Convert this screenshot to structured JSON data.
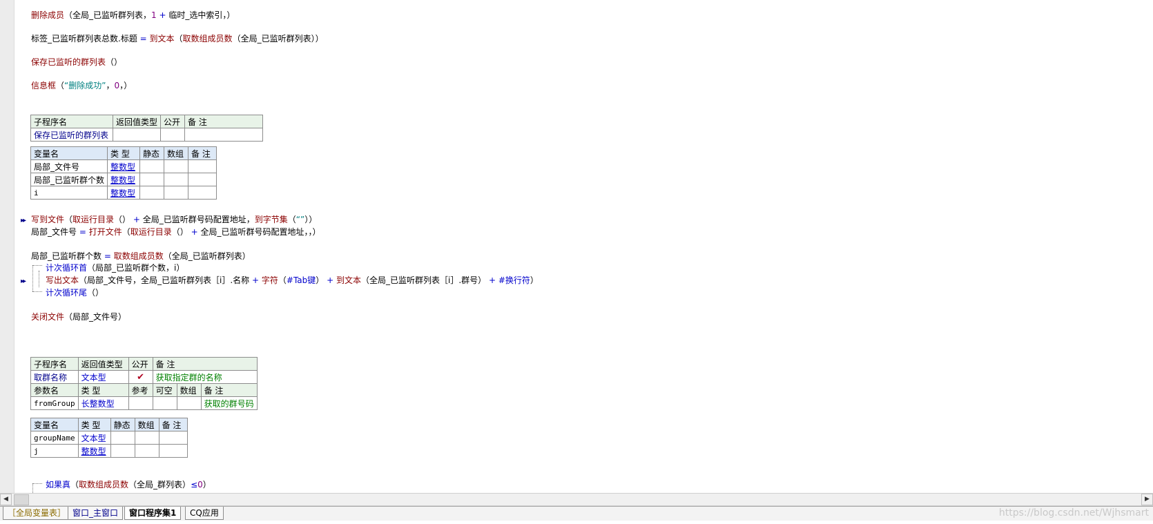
{
  "code": {
    "l1": {
      "fn": "删除成员",
      "args": "（全局_已监听群列表，",
      "num": "1",
      "op": " + ",
      "rest": "临时_选中索引，）"
    },
    "l2": {
      "a": "标签_已监听群列表总数.标题",
      "op": " = ",
      "fn": "到文本",
      "b": "（",
      "fn2": "取数组成员数",
      "c": "（全局_已监听群列表））"
    },
    "l3": {
      "fn": "保存已监听的群列表",
      "args": "（）"
    },
    "l4": {
      "fn": "信息框",
      "a": "（",
      "str": "“删除成功”",
      "b": "，",
      "num": "0",
      "c": "，）"
    },
    "l5": {
      "fn": "写到文件",
      "a": "（",
      "fn2": "取运行目录",
      "b": "（）",
      "op": " + ",
      "c": "全局_已监听群号码配置地址，",
      "fn3": "到字节集",
      "d": "（",
      "str": "“”",
      "e": "））"
    },
    "l6": {
      "a": "局部_文件号",
      "op": " = ",
      "fn": "打开文件",
      "b": "（",
      "fn2": "取运行目录",
      "c": "（）",
      "op2": " + ",
      "d": "全局_已监听群号码配置地址，，）"
    },
    "l7": {
      "a": "局部_已监听群个数",
      "op": " = ",
      "fn": "取数组成员数",
      "b": "（全局_已监听群列表）"
    },
    "l8": {
      "cmd": "计次循环首",
      "args": "（局部_已监听群个数，i）"
    },
    "l9": {
      "fn": "写出文本",
      "a": "（局部_文件号，全局_已监听群列表［i］.名称",
      "op": " + ",
      "fn2": "字符",
      "b": "（",
      "cmd": "#Tab键",
      "c": "）",
      "op2": " + ",
      "fn3": "到文本",
      "d": "（全局_已监听群列表［i］.群号）",
      "op3": " + ",
      "cmd2": "#换行符",
      "e": "）"
    },
    "l10": {
      "cmd": "计次循环尾",
      "args": "（）"
    },
    "l11": {
      "fn": "关闭文件",
      "args": "（局部_文件号）"
    },
    "l12": {
      "cmd": "如果真",
      "a": "（",
      "fn": "取数组成员数",
      "b": "（全局_群列表）",
      "op": "≤",
      "num": "0",
      "c": "）"
    }
  },
  "sub1": {
    "headers": [
      "子程序名",
      "返回值类型",
      "公开",
      "备 注"
    ],
    "name": "保存已监听的群列表",
    "var_headers": [
      "变量名",
      "类 型",
      "静态",
      "数组",
      "备 注"
    ],
    "vars": [
      {
        "name": "局部_文件号",
        "type": "整数型"
      },
      {
        "name": "局部_已监听群个数",
        "type": "整数型"
      },
      {
        "name": "i",
        "type": "整数型"
      }
    ]
  },
  "sub2": {
    "headers": [
      "子程序名",
      "返回值类型",
      "公开",
      "备 注"
    ],
    "name": "取群名称",
    "ret": "文本型",
    "public": "✔",
    "note": "获取指定群的名称",
    "param_headers": [
      "参数名",
      "类 型",
      "参考",
      "可空",
      "数组",
      "备 注"
    ],
    "param": {
      "name": "fromGroup",
      "type": "长整数型",
      "note": "获取的群号码"
    },
    "var_headers": [
      "变量名",
      "类 型",
      "静态",
      "数组",
      "备 注"
    ],
    "vars": [
      {
        "name": "groupName",
        "type": "文本型"
      },
      {
        "name": "j",
        "type": "整数型"
      }
    ]
  },
  "tabs": [
    "［全局变量表］",
    "窗口_主窗口",
    "窗口程序集1",
    "CQ应用"
  ],
  "watermark": "https://blog.csdn.net/Wjhsmart",
  "icons": {
    "scroll_left": "◀",
    "scroll_right": "▶",
    "run_marker": "▸▸"
  },
  "colors": {
    "function": "#8b0000",
    "command": "#0000cc",
    "string": "#008080",
    "number": "#800080",
    "comment": "#008000"
  }
}
